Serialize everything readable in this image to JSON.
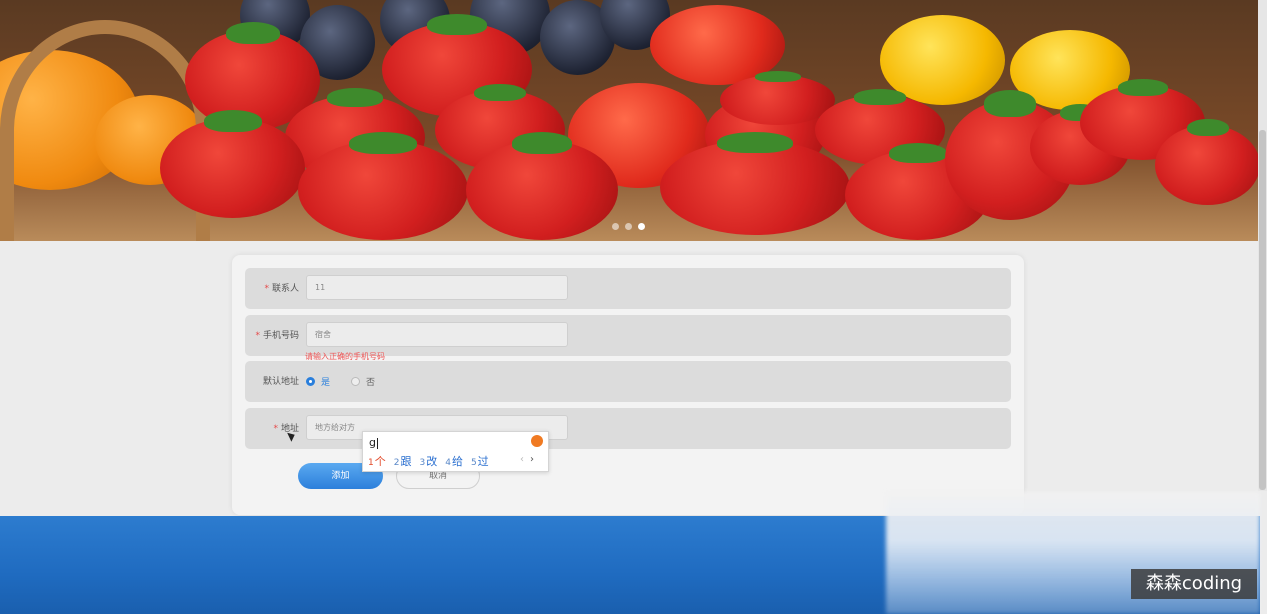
{
  "carousel": {
    "dots": 3,
    "active_index": 2
  },
  "form": {
    "contact": {
      "label": "联系人",
      "value": "11",
      "required": true
    },
    "phone": {
      "label": "手机号码",
      "value": "宿舍",
      "required": true,
      "error": "请输入正确的手机号码"
    },
    "default_address": {
      "label": "默认地址",
      "options": [
        "是",
        "否"
      ],
      "selected": "是"
    },
    "address": {
      "label": "地址",
      "placeholder": "地方给对方",
      "required": true
    }
  },
  "buttons": {
    "add": "添加",
    "cancel": "取消"
  },
  "ime": {
    "composition": "g",
    "candidates": [
      {
        "num": "1",
        "text": "个"
      },
      {
        "num": "2",
        "text": "跟"
      },
      {
        "num": "3",
        "text": "改"
      },
      {
        "num": "4",
        "text": "给"
      },
      {
        "num": "5",
        "text": "过"
      }
    ],
    "prev": "‹",
    "next": "›"
  },
  "watermark": "森森coding",
  "colors": {
    "accent": "#2c7fdb",
    "required": "#e64a4a",
    "footer": "#1f6bc0"
  }
}
